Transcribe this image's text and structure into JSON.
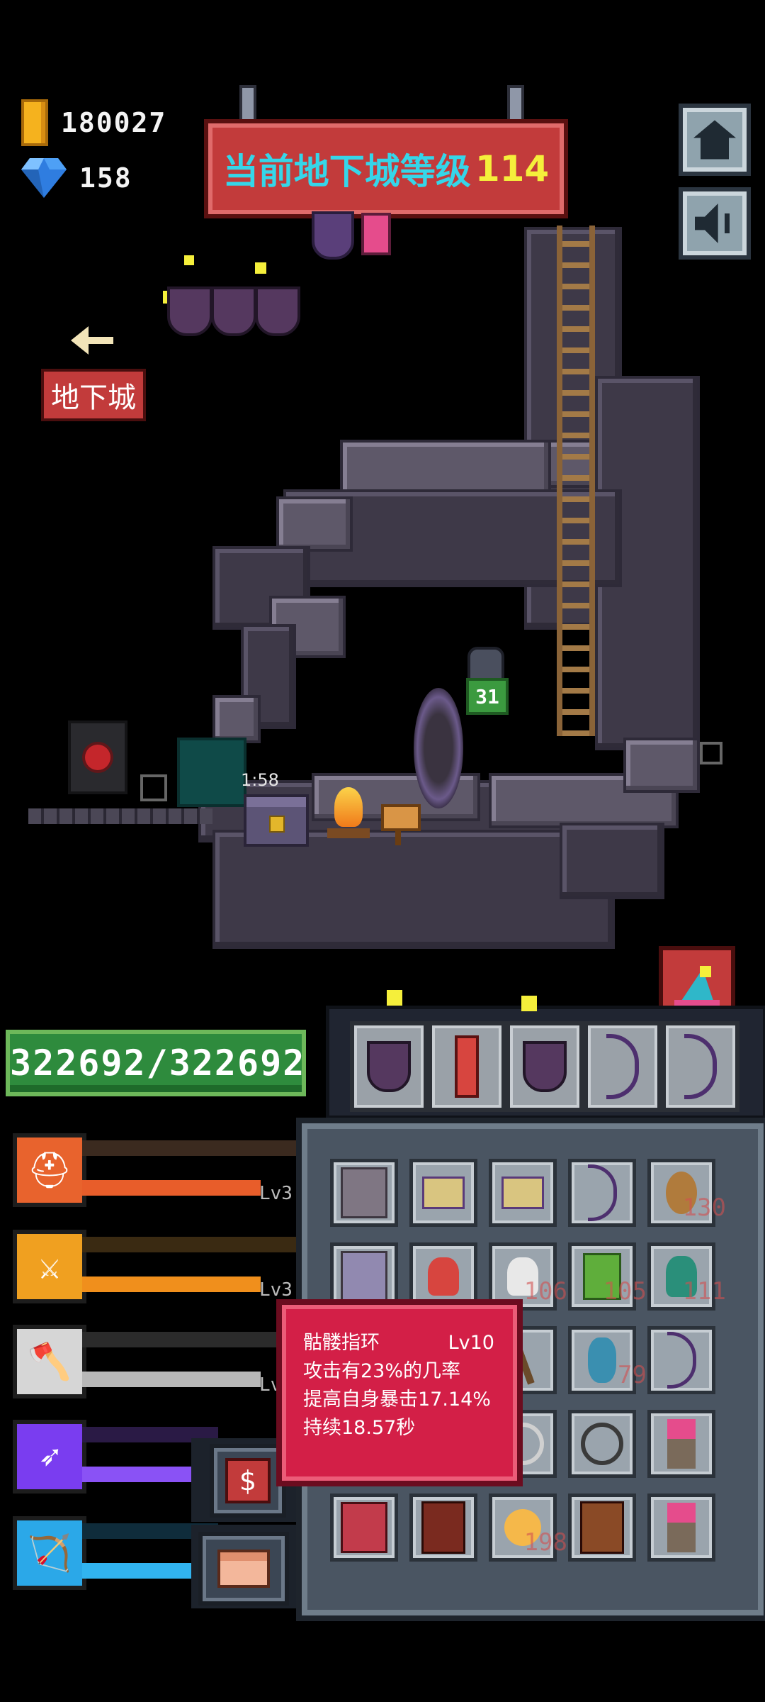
{
  "currency": {
    "gold": "180027",
    "gems": "158",
    "gold_icon": "gold-coin-icon",
    "gem_icon": "diamond-icon"
  },
  "banner": {
    "title": "当前地下城等级",
    "level": "114"
  },
  "buttons": {
    "home_icon": "home-icon",
    "sound_icon": "speaker-icon",
    "dungeon_label": "地下城",
    "shop_symbol": "$"
  },
  "world": {
    "chest_timer": "1:58",
    "enemy_level": "31"
  },
  "player": {
    "hp_text": "322692/322692"
  },
  "skills": [
    {
      "name": "helmet-skill",
      "lv": "Lv3",
      "color": "#e8632d"
    },
    {
      "name": "crossed-swords-skill",
      "lv": "Lv3",
      "color": "#f0a020"
    },
    {
      "name": "axe-skill",
      "lv": "Lv",
      "color": "#cfcfcf"
    },
    {
      "name": "arrows-skill",
      "lv": "",
      "color": "#7a3df0"
    },
    {
      "name": "bow-skill",
      "lv": "",
      "color": "#2ba8e8"
    }
  ],
  "inventory": {
    "counts": {
      "r1c5": "130",
      "r2c3": "106",
      "r2c4": "105",
      "r2c5": "111",
      "r3c4": "79",
      "r5c3": "198"
    }
  },
  "tooltip": {
    "name": "骷髅指环",
    "level": "Lv10",
    "line1": "攻击有23%的几率",
    "line2": "提高自身暴击17.14%",
    "line3": "持续18.57秒"
  }
}
